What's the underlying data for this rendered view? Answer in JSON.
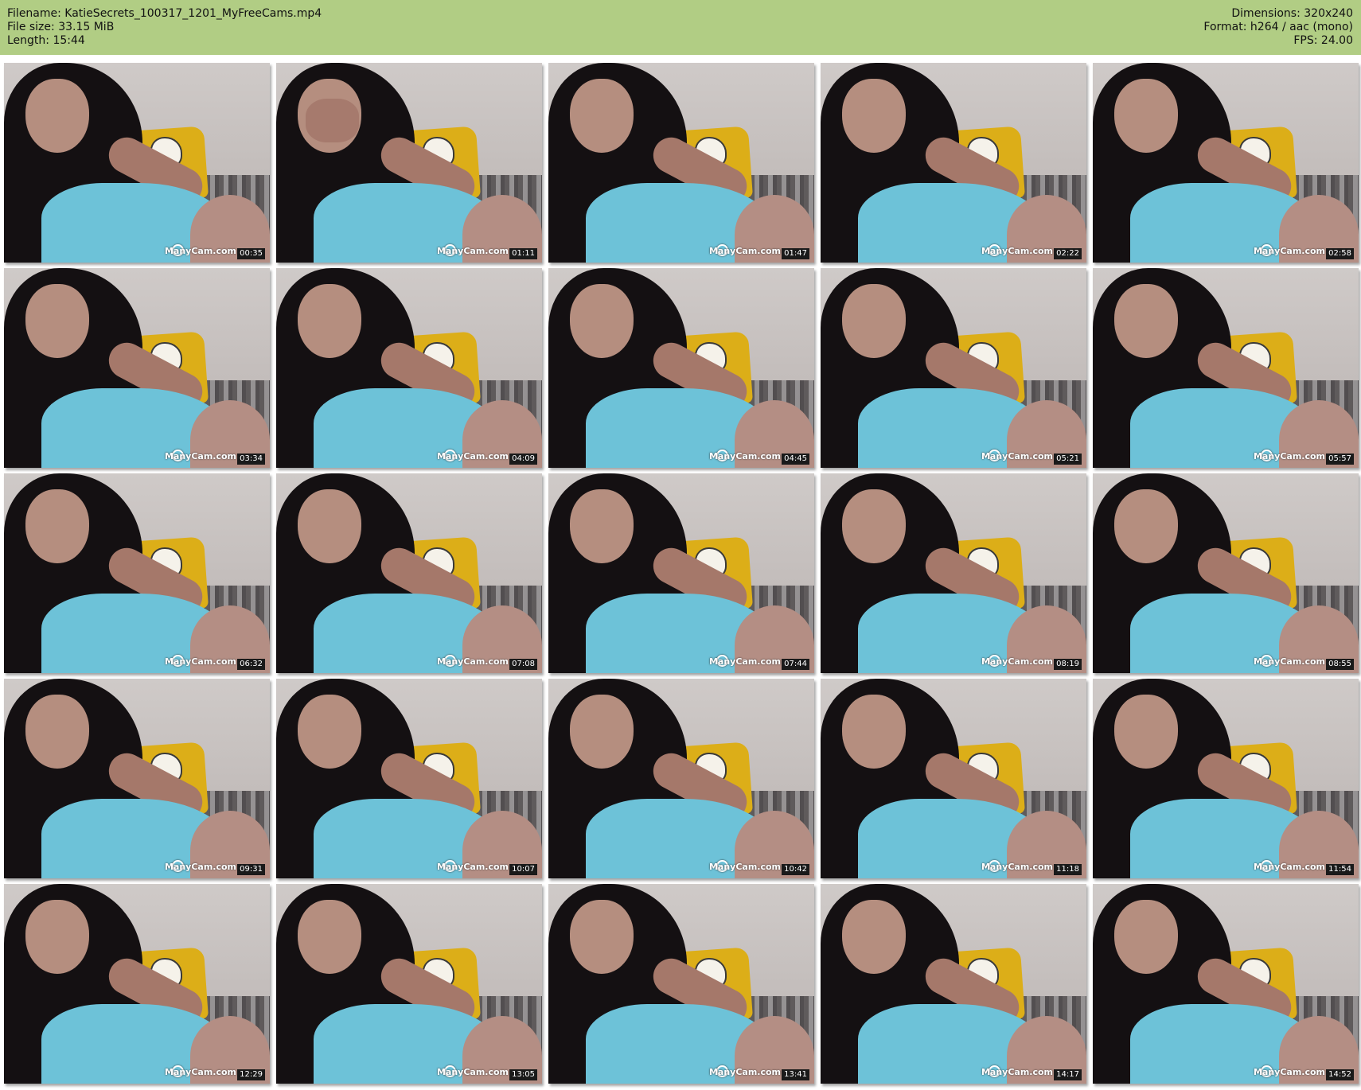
{
  "header": {
    "filename": "Filename: KatieSecrets_100317_1201_MyFreeCams.mp4",
    "filesize": "File size: 33.15 MiB",
    "length": "Length: 15:44",
    "dimensions": "Dimensions: 320x240",
    "format": "Format: h264 / aac (mono)",
    "fps": "FPS: 24.00"
  },
  "colors": {
    "header_bg": "#b1cd84",
    "page_bg": "#ffffff"
  },
  "frames": [
    {
      "timestamp": "00:35",
      "logo": "ManyCam.com"
    },
    {
      "timestamp": "01:11",
      "logo": "ManyCam.com"
    },
    {
      "timestamp": "01:47",
      "logo": "ManyCam.com"
    },
    {
      "timestamp": "02:22",
      "logo": "ManyCam.com"
    },
    {
      "timestamp": "02:58",
      "logo": "ManyCam.com"
    },
    {
      "timestamp": "03:34",
      "logo": "ManyCam.com"
    },
    {
      "timestamp": "04:09",
      "logo": "ManyCam.com"
    },
    {
      "timestamp": "04:45",
      "logo": "ManyCam.com"
    },
    {
      "timestamp": "05:21",
      "logo": "ManyCam.com"
    },
    {
      "timestamp": "05:57",
      "logo": "ManyCam.com"
    },
    {
      "timestamp": "06:32",
      "logo": "ManyCam.com"
    },
    {
      "timestamp": "07:08",
      "logo": "ManyCam.com"
    },
    {
      "timestamp": "07:44",
      "logo": "ManyCam.com"
    },
    {
      "timestamp": "08:19",
      "logo": "ManyCam.com"
    },
    {
      "timestamp": "08:55",
      "logo": "ManyCam.com"
    },
    {
      "timestamp": "09:31",
      "logo": "ManyCam.com"
    },
    {
      "timestamp": "10:07",
      "logo": "ManyCam.com"
    },
    {
      "timestamp": "10:42",
      "logo": "ManyCam.com"
    },
    {
      "timestamp": "11:18",
      "logo": "ManyCam.com"
    },
    {
      "timestamp": "11:54",
      "logo": "ManyCam.com"
    },
    {
      "timestamp": "12:29",
      "logo": "ManyCam.com"
    },
    {
      "timestamp": "13:05",
      "logo": "ManyCam.com"
    },
    {
      "timestamp": "13:41",
      "logo": "ManyCam.com"
    },
    {
      "timestamp": "14:17",
      "logo": "ManyCam.com"
    },
    {
      "timestamp": "14:52",
      "logo": "ManyCam.com"
    }
  ]
}
